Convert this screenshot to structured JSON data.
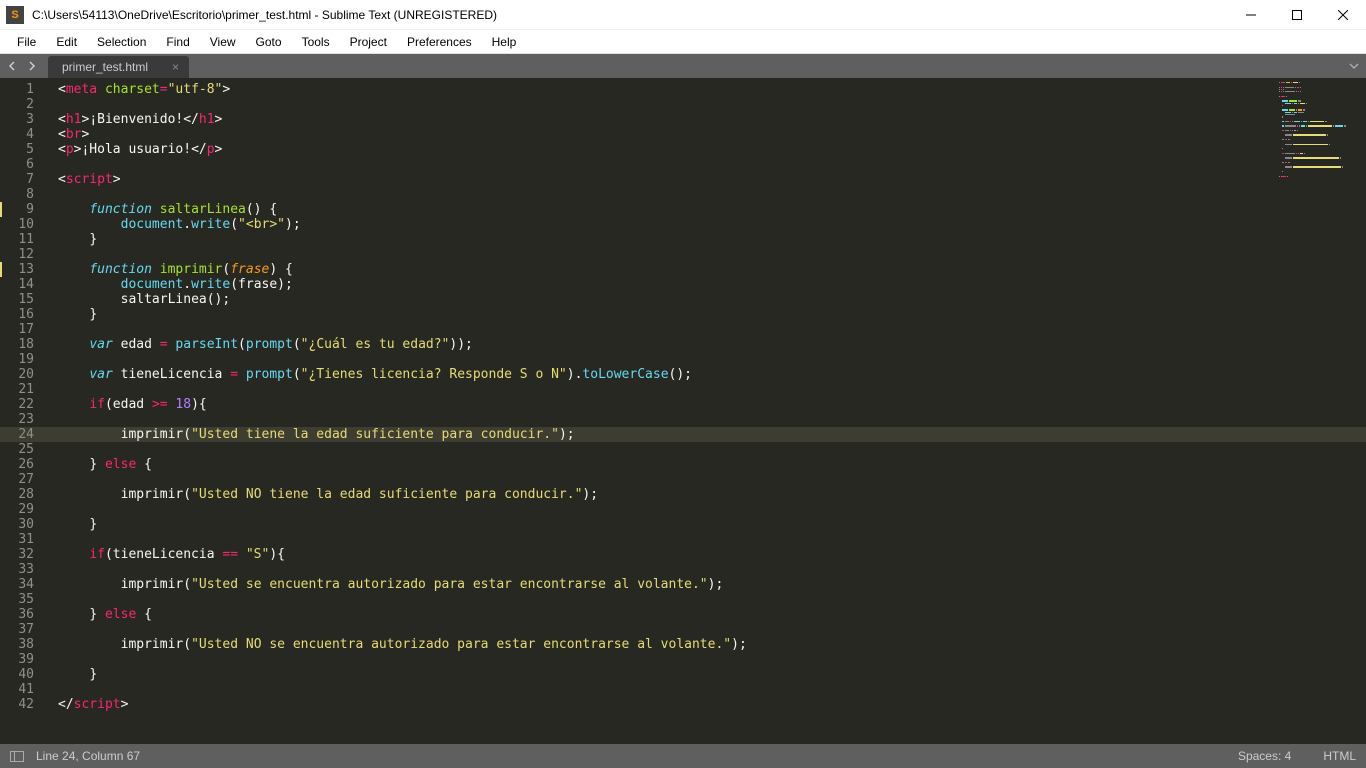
{
  "window": {
    "title": "C:\\Users\\54113\\OneDrive\\Escritorio\\primer_test.html - Sublime Text (UNREGISTERED)"
  },
  "menu": {
    "file": "File",
    "edit": "Edit",
    "selection": "Selection",
    "find": "Find",
    "view": "View",
    "goto": "Goto",
    "tools": "Tools",
    "project": "Project",
    "preferences": "Preferences",
    "help": "Help"
  },
  "tab": {
    "label": "primer_test.html"
  },
  "status": {
    "cursor": "Line 24, Column 67",
    "spaces": "Spaces: 4",
    "syntax": "HTML"
  },
  "code": {
    "current_line": 24,
    "lines": [
      {
        "n": 1,
        "tokens": [
          [
            "c-punc",
            "<"
          ],
          [
            "c-tag",
            "meta "
          ],
          [
            "c-attr",
            "charset"
          ],
          [
            "c-op",
            "="
          ],
          [
            "c-str",
            "\"utf-8\""
          ],
          [
            "c-punc",
            ">"
          ]
        ]
      },
      {
        "n": 2,
        "tokens": []
      },
      {
        "n": 3,
        "tokens": [
          [
            "c-punc",
            "<"
          ],
          [
            "c-tag",
            "h1"
          ],
          [
            "c-punc",
            ">"
          ],
          [
            "c-var",
            "¡Bienvenido!"
          ],
          [
            "c-punc",
            "</"
          ],
          [
            "c-tag",
            "h1"
          ],
          [
            "c-punc",
            ">"
          ]
        ]
      },
      {
        "n": 4,
        "tokens": [
          [
            "c-punc",
            "<"
          ],
          [
            "c-tag",
            "br"
          ],
          [
            "c-punc",
            ">"
          ]
        ]
      },
      {
        "n": 5,
        "tokens": [
          [
            "c-punc",
            "<"
          ],
          [
            "c-tag",
            "p"
          ],
          [
            "c-punc",
            ">"
          ],
          [
            "c-var",
            "¡Hola usuario!"
          ],
          [
            "c-punc",
            "</"
          ],
          [
            "c-tag",
            "p"
          ],
          [
            "c-punc",
            ">"
          ]
        ]
      },
      {
        "n": 6,
        "tokens": []
      },
      {
        "n": 7,
        "tokens": [
          [
            "c-punc",
            "<"
          ],
          [
            "c-tag",
            "script"
          ],
          [
            "c-punc",
            ">"
          ]
        ]
      },
      {
        "n": 8,
        "tokens": []
      },
      {
        "n": 9,
        "modified": true,
        "indent": 3,
        "tokens": [
          [
            "c-kw",
            "function "
          ],
          [
            "c-fn",
            "saltarLinea"
          ],
          [
            "c-punc",
            "() {"
          ]
        ]
      },
      {
        "n": 10,
        "indent": 7,
        "tokens": [
          [
            "c-st",
            "document"
          ],
          [
            "c-punc",
            "."
          ],
          [
            "c-call",
            "write"
          ],
          [
            "c-punc",
            "("
          ],
          [
            "c-str",
            "\"<br>\""
          ],
          [
            "c-punc",
            ");"
          ]
        ]
      },
      {
        "n": 11,
        "indent": 3,
        "tokens": [
          [
            "c-punc",
            "}"
          ]
        ]
      },
      {
        "n": 12,
        "tokens": []
      },
      {
        "n": 13,
        "modified": true,
        "indent": 3,
        "tokens": [
          [
            "c-kw",
            "function "
          ],
          [
            "c-fn",
            "imprimir"
          ],
          [
            "c-punc",
            "("
          ],
          [
            "c-param",
            "frase"
          ],
          [
            "c-punc",
            ") {"
          ]
        ]
      },
      {
        "n": 14,
        "indent": 7,
        "tokens": [
          [
            "c-st",
            "document"
          ],
          [
            "c-punc",
            "."
          ],
          [
            "c-call",
            "write"
          ],
          [
            "c-punc",
            "(frase);"
          ]
        ]
      },
      {
        "n": 15,
        "indent": 7,
        "tokens": [
          [
            "c-var",
            "saltarLinea();"
          ]
        ]
      },
      {
        "n": 16,
        "indent": 3,
        "tokens": [
          [
            "c-punc",
            "}"
          ]
        ]
      },
      {
        "n": 17,
        "tokens": []
      },
      {
        "n": 18,
        "indent": 3,
        "tokens": [
          [
            "c-kw",
            "var"
          ],
          [
            "c-var",
            " edad "
          ],
          [
            "c-op",
            "="
          ],
          [
            "c-var",
            " "
          ],
          [
            "c-call",
            "parseInt"
          ],
          [
            "c-punc",
            "("
          ],
          [
            "c-call",
            "prompt"
          ],
          [
            "c-punc",
            "("
          ],
          [
            "c-str",
            "\"¿Cuál es tu edad?\""
          ],
          [
            "c-punc",
            "));"
          ]
        ]
      },
      {
        "n": 19,
        "tokens": []
      },
      {
        "n": 20,
        "indent": 3,
        "tokens": [
          [
            "c-kw",
            "var"
          ],
          [
            "c-var",
            " tieneLicencia "
          ],
          [
            "c-op",
            "="
          ],
          [
            "c-var",
            " "
          ],
          [
            "c-call",
            "prompt"
          ],
          [
            "c-punc",
            "("
          ],
          [
            "c-str",
            "\"¿Tienes licencia? Responde S o N\""
          ],
          [
            "c-punc",
            ")."
          ],
          [
            "c-call",
            "toLowerCase"
          ],
          [
            "c-punc",
            "();"
          ]
        ]
      },
      {
        "n": 21,
        "tokens": []
      },
      {
        "n": 22,
        "indent": 3,
        "tokens": [
          [
            "c-kw2",
            "if"
          ],
          [
            "c-punc",
            "(edad "
          ],
          [
            "c-op",
            ">="
          ],
          [
            "c-punc",
            " "
          ],
          [
            "c-num",
            "18"
          ],
          [
            "c-punc",
            "){"
          ]
        ]
      },
      {
        "n": 23,
        "tokens": []
      },
      {
        "n": 24,
        "indent": 7,
        "tokens": [
          [
            "c-var",
            "imprimir("
          ],
          [
            "c-str",
            "\"Usted tiene la edad suficiente para conducir.\""
          ],
          [
            "c-punc",
            ");"
          ]
        ]
      },
      {
        "n": 25,
        "tokens": []
      },
      {
        "n": 26,
        "indent": 3,
        "tokens": [
          [
            "c-punc",
            "} "
          ],
          [
            "c-kw2",
            "else"
          ],
          [
            "c-punc",
            " {"
          ]
        ]
      },
      {
        "n": 27,
        "tokens": []
      },
      {
        "n": 28,
        "indent": 7,
        "tokens": [
          [
            "c-var",
            "imprimir("
          ],
          [
            "c-str",
            "\"Usted NO tiene la edad suficiente para conducir.\""
          ],
          [
            "c-punc",
            ");"
          ]
        ]
      },
      {
        "n": 29,
        "tokens": []
      },
      {
        "n": 30,
        "indent": 3,
        "tokens": [
          [
            "c-punc",
            "}"
          ]
        ]
      },
      {
        "n": 31,
        "tokens": []
      },
      {
        "n": 32,
        "indent": 3,
        "tokens": [
          [
            "c-kw2",
            "if"
          ],
          [
            "c-punc",
            "(tieneLicencia "
          ],
          [
            "c-op",
            "=="
          ],
          [
            "c-punc",
            " "
          ],
          [
            "c-str",
            "\"S\""
          ],
          [
            "c-punc",
            "){"
          ]
        ]
      },
      {
        "n": 33,
        "tokens": []
      },
      {
        "n": 34,
        "indent": 7,
        "tokens": [
          [
            "c-var",
            "imprimir("
          ],
          [
            "c-str",
            "\"Usted se encuentra autorizado para estar encontrarse al volante.\""
          ],
          [
            "c-punc",
            ");"
          ]
        ]
      },
      {
        "n": 35,
        "tokens": []
      },
      {
        "n": 36,
        "indent": 3,
        "tokens": [
          [
            "c-punc",
            "} "
          ],
          [
            "c-kw2",
            "else"
          ],
          [
            "c-punc",
            " {"
          ]
        ]
      },
      {
        "n": 37,
        "tokens": []
      },
      {
        "n": 38,
        "indent": 7,
        "tokens": [
          [
            "c-var",
            "imprimir("
          ],
          [
            "c-str",
            "\"Usted NO se encuentra autorizado para estar encontrarse al volante.\""
          ],
          [
            "c-punc",
            ");"
          ]
        ]
      },
      {
        "n": 39,
        "tokens": []
      },
      {
        "n": 40,
        "indent": 3,
        "tokens": [
          [
            "c-punc",
            "}"
          ]
        ]
      },
      {
        "n": 41,
        "tokens": []
      },
      {
        "n": 42,
        "tokens": [
          [
            "c-punc",
            "</"
          ],
          [
            "c-tag",
            "script"
          ],
          [
            "c-punc",
            ">"
          ]
        ]
      }
    ]
  }
}
